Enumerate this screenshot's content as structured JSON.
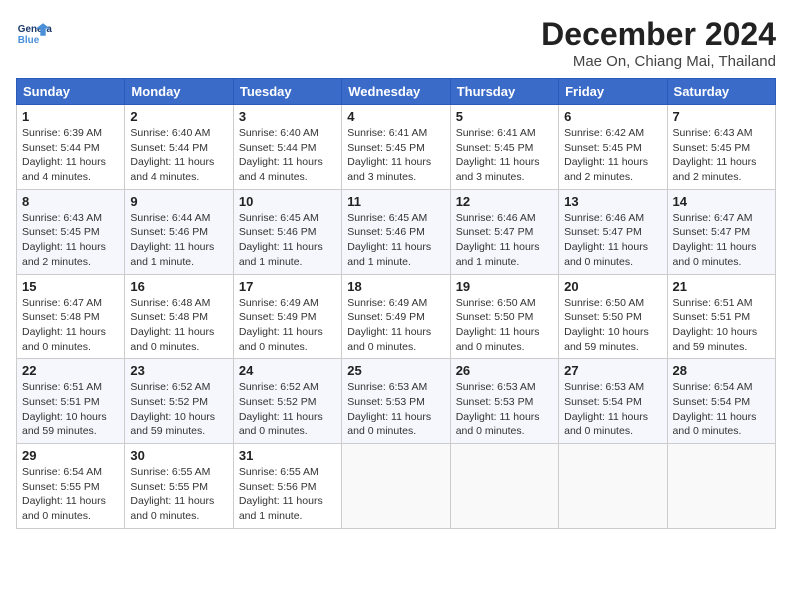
{
  "header": {
    "logo_general": "General",
    "logo_blue": "Blue",
    "month_title": "December 2024",
    "location": "Mae On, Chiang Mai, Thailand"
  },
  "weekdays": [
    "Sunday",
    "Monday",
    "Tuesday",
    "Wednesday",
    "Thursday",
    "Friday",
    "Saturday"
  ],
  "weeks": [
    [
      {
        "day": "1",
        "info": "Sunrise: 6:39 AM\nSunset: 5:44 PM\nDaylight: 11 hours\nand 4 minutes."
      },
      {
        "day": "2",
        "info": "Sunrise: 6:40 AM\nSunset: 5:44 PM\nDaylight: 11 hours\nand 4 minutes."
      },
      {
        "day": "3",
        "info": "Sunrise: 6:40 AM\nSunset: 5:44 PM\nDaylight: 11 hours\nand 4 minutes."
      },
      {
        "day": "4",
        "info": "Sunrise: 6:41 AM\nSunset: 5:45 PM\nDaylight: 11 hours\nand 3 minutes."
      },
      {
        "day": "5",
        "info": "Sunrise: 6:41 AM\nSunset: 5:45 PM\nDaylight: 11 hours\nand 3 minutes."
      },
      {
        "day": "6",
        "info": "Sunrise: 6:42 AM\nSunset: 5:45 PM\nDaylight: 11 hours\nand 2 minutes."
      },
      {
        "day": "7",
        "info": "Sunrise: 6:43 AM\nSunset: 5:45 PM\nDaylight: 11 hours\nand 2 minutes."
      }
    ],
    [
      {
        "day": "8",
        "info": "Sunrise: 6:43 AM\nSunset: 5:45 PM\nDaylight: 11 hours\nand 2 minutes."
      },
      {
        "day": "9",
        "info": "Sunrise: 6:44 AM\nSunset: 5:46 PM\nDaylight: 11 hours\nand 1 minute."
      },
      {
        "day": "10",
        "info": "Sunrise: 6:45 AM\nSunset: 5:46 PM\nDaylight: 11 hours\nand 1 minute."
      },
      {
        "day": "11",
        "info": "Sunrise: 6:45 AM\nSunset: 5:46 PM\nDaylight: 11 hours\nand 1 minute."
      },
      {
        "day": "12",
        "info": "Sunrise: 6:46 AM\nSunset: 5:47 PM\nDaylight: 11 hours\nand 1 minute."
      },
      {
        "day": "13",
        "info": "Sunrise: 6:46 AM\nSunset: 5:47 PM\nDaylight: 11 hours\nand 0 minutes."
      },
      {
        "day": "14",
        "info": "Sunrise: 6:47 AM\nSunset: 5:47 PM\nDaylight: 11 hours\nand 0 minutes."
      }
    ],
    [
      {
        "day": "15",
        "info": "Sunrise: 6:47 AM\nSunset: 5:48 PM\nDaylight: 11 hours\nand 0 minutes."
      },
      {
        "day": "16",
        "info": "Sunrise: 6:48 AM\nSunset: 5:48 PM\nDaylight: 11 hours\nand 0 minutes."
      },
      {
        "day": "17",
        "info": "Sunrise: 6:49 AM\nSunset: 5:49 PM\nDaylight: 11 hours\nand 0 minutes."
      },
      {
        "day": "18",
        "info": "Sunrise: 6:49 AM\nSunset: 5:49 PM\nDaylight: 11 hours\nand 0 minutes."
      },
      {
        "day": "19",
        "info": "Sunrise: 6:50 AM\nSunset: 5:50 PM\nDaylight: 11 hours\nand 0 minutes."
      },
      {
        "day": "20",
        "info": "Sunrise: 6:50 AM\nSunset: 5:50 PM\nDaylight: 10 hours\nand 59 minutes."
      },
      {
        "day": "21",
        "info": "Sunrise: 6:51 AM\nSunset: 5:51 PM\nDaylight: 10 hours\nand 59 minutes."
      }
    ],
    [
      {
        "day": "22",
        "info": "Sunrise: 6:51 AM\nSunset: 5:51 PM\nDaylight: 10 hours\nand 59 minutes."
      },
      {
        "day": "23",
        "info": "Sunrise: 6:52 AM\nSunset: 5:52 PM\nDaylight: 10 hours\nand 59 minutes."
      },
      {
        "day": "24",
        "info": "Sunrise: 6:52 AM\nSunset: 5:52 PM\nDaylight: 11 hours\nand 0 minutes."
      },
      {
        "day": "25",
        "info": "Sunrise: 6:53 AM\nSunset: 5:53 PM\nDaylight: 11 hours\nand 0 minutes."
      },
      {
        "day": "26",
        "info": "Sunrise: 6:53 AM\nSunset: 5:53 PM\nDaylight: 11 hours\nand 0 minutes."
      },
      {
        "day": "27",
        "info": "Sunrise: 6:53 AM\nSunset: 5:54 PM\nDaylight: 11 hours\nand 0 minutes."
      },
      {
        "day": "28",
        "info": "Sunrise: 6:54 AM\nSunset: 5:54 PM\nDaylight: 11 hours\nand 0 minutes."
      }
    ],
    [
      {
        "day": "29",
        "info": "Sunrise: 6:54 AM\nSunset: 5:55 PM\nDaylight: 11 hours\nand 0 minutes."
      },
      {
        "day": "30",
        "info": "Sunrise: 6:55 AM\nSunset: 5:55 PM\nDaylight: 11 hours\nand 0 minutes."
      },
      {
        "day": "31",
        "info": "Sunrise: 6:55 AM\nSunset: 5:56 PM\nDaylight: 11 hours\nand 1 minute."
      },
      null,
      null,
      null,
      null
    ]
  ]
}
